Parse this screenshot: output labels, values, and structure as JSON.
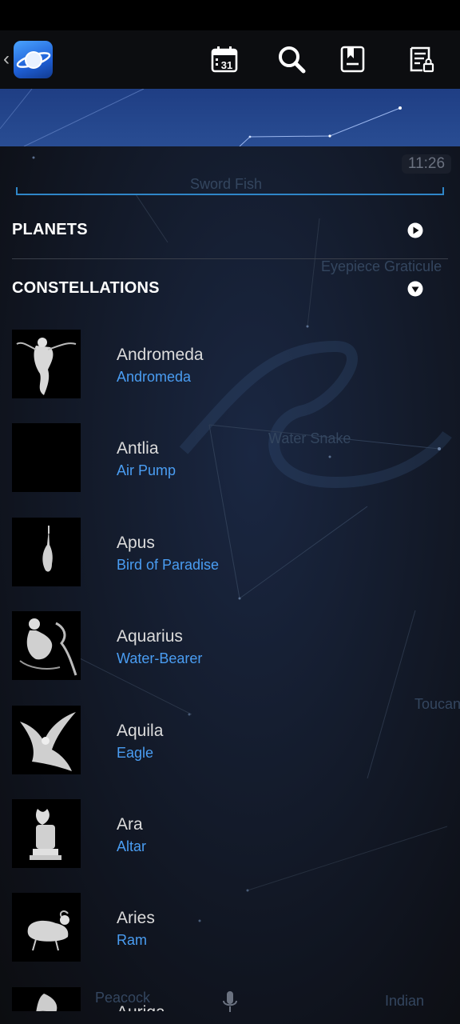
{
  "toolbar": {
    "back_icon": "chevron-left-icon",
    "logo_icon": "saturn-app-icon",
    "calendar_day": "31",
    "search_icon": "search-icon",
    "bookmark_icon": "bookmark-icon",
    "lock_doc_icon": "locked-document-icon"
  },
  "sky_overlay": {
    "time": "11:26",
    "labels": [
      "Sword Fish",
      "Eyepiece Graticule",
      "Water Snake",
      "Toucan",
      "Peacock",
      "Indian"
    ]
  },
  "sections": {
    "planets": {
      "title": "PLANETS",
      "state": "collapsed"
    },
    "constellations": {
      "title": "CONSTELLATIONS",
      "state": "expanded"
    }
  },
  "constellations": [
    {
      "name": "Andromeda",
      "common": "Andromeda"
    },
    {
      "name": "Antlia",
      "common": "Air Pump"
    },
    {
      "name": "Apus",
      "common": "Bird of Paradise"
    },
    {
      "name": "Aquarius",
      "common": "Water-Bearer"
    },
    {
      "name": "Aquila",
      "common": "Eagle"
    },
    {
      "name": "Ara",
      "common": "Altar"
    },
    {
      "name": "Aries",
      "common": "Ram"
    },
    {
      "name": "Auriga",
      "common": ""
    }
  ],
  "colors": {
    "accent_blue": "#4a9df2",
    "underline_blue": "#2f86c8",
    "app_bar": "#0c0d10"
  }
}
